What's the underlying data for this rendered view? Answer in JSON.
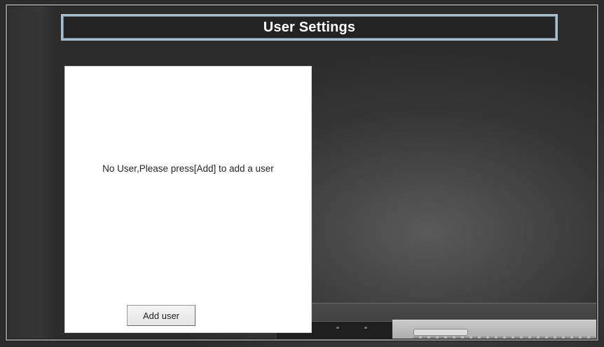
{
  "header": {
    "title": "User Settings"
  },
  "user_list": {
    "empty_message": "No User,Please press[Add] to add a user",
    "add_button_label": "Add user"
  },
  "colors": {
    "title_border": "#a9bfcf",
    "title_background": "#232323",
    "panel_background": "#ffffff",
    "screen_background": "#3a3a3a"
  }
}
